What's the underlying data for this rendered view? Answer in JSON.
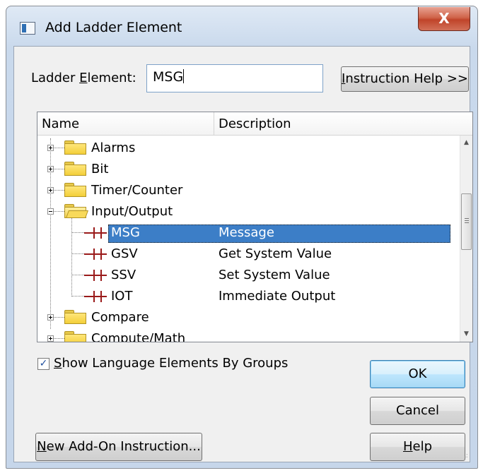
{
  "dialog": {
    "title": "Add Ladder Element",
    "close_label": "X"
  },
  "element_field": {
    "label_u": "E",
    "label_pre": "Ladder ",
    "label_post": "lement:",
    "value": "MSG"
  },
  "buttons": {
    "instruction_help": {
      "u": "I",
      "rest": "nstruction Help >>"
    },
    "ok": "OK",
    "cancel": "Cancel",
    "help": {
      "u": "H",
      "rest": "elp"
    },
    "new_aoi": {
      "u": "N",
      "rest": "ew Add-On Instruction..."
    }
  },
  "list": {
    "columns": [
      "Name",
      "Description"
    ],
    "rows": [
      {
        "type": "group",
        "name": "Alarms",
        "expanded": false
      },
      {
        "type": "group",
        "name": "Bit",
        "expanded": false
      },
      {
        "type": "group",
        "name": "Timer/Counter",
        "expanded": false
      },
      {
        "type": "group",
        "name": "Input/Output",
        "expanded": true
      },
      {
        "type": "item",
        "name": "MSG",
        "description": "Message",
        "selected": true
      },
      {
        "type": "item",
        "name": "GSV",
        "description": "Get System Value"
      },
      {
        "type": "item",
        "name": "SSV",
        "description": "Set System Value"
      },
      {
        "type": "item",
        "name": "IOT",
        "description": "Immediate Output"
      },
      {
        "type": "group",
        "name": "Compare",
        "expanded": false
      },
      {
        "type": "group",
        "name": "Compute/Math",
        "expanded": false
      }
    ]
  },
  "show_groups": {
    "checked": true,
    "u": "S",
    "rest": "how Language Elements By Groups"
  },
  "colors": {
    "selection": "#3c7ec7",
    "close_button": "#c9503a",
    "ladder_icon": "#9a1a1a"
  }
}
